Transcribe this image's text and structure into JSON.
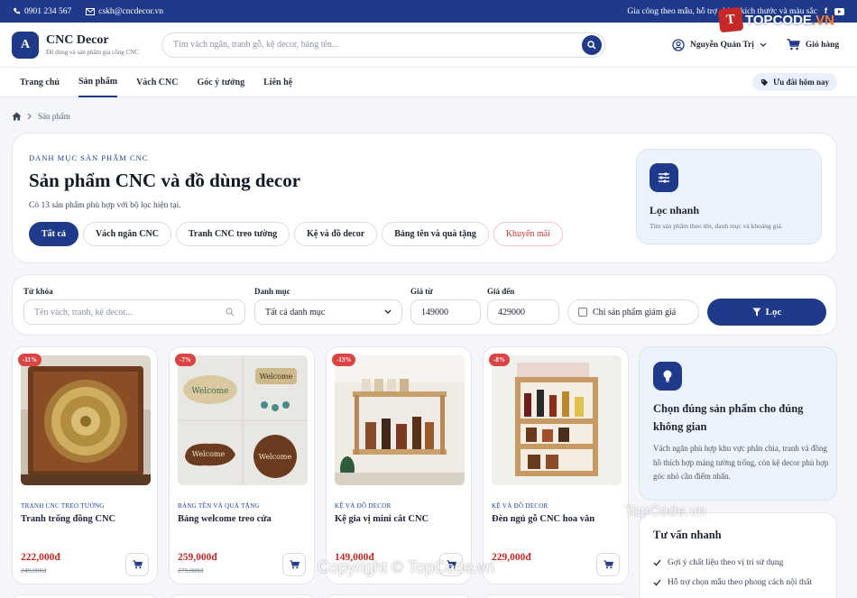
{
  "topbar": {
    "phone": "0901 234 567",
    "email": "cskh@cncdecor.vn",
    "promo": "Gia công theo mẫu, hỗ trợ chỉnh kích thước và màu sắc"
  },
  "brand": {
    "logo_letter": "A",
    "name": "CNC Decor",
    "tagline": "Đồ dùng và sản phẩm gia công CNC"
  },
  "search": {
    "placeholder": "Tìm vách ngăn, tranh gỗ, kệ decor, bảng tên..."
  },
  "user": {
    "name": "Nguyễn Quản Trị"
  },
  "cart": {
    "label": "Giỏ hàng"
  },
  "nav": {
    "items": [
      "Trang chủ",
      "Sản phẩm",
      "Vách CNC",
      "Góc ý tưởng",
      "Liên hệ"
    ],
    "active_index": 1,
    "deal_label": "Ưu đãi hôm nay"
  },
  "breadcrumb": {
    "current": "Sản phẩm"
  },
  "hero": {
    "kicker": "DANH MỤC SẢN PHẨM CNC",
    "title": "Sản phẩm CNC và đồ dùng decor",
    "subtitle": "Có 13 sản phẩm phù hợp với bộ lọc hiện tại.",
    "chips": [
      "Tất cả",
      "Vách ngăn CNC",
      "Tranh CNC treo tường",
      "Kệ và đồ decor",
      "Bảng tên và quà tặng",
      "Khuyến mãi"
    ],
    "quick_title": "Lọc nhanh",
    "quick_desc": "Tìm sản phẩm theo tên, danh mục và khoảng giá."
  },
  "filter": {
    "keyword_label": "Từ khóa",
    "keyword_placeholder": "Tên vách, tranh, kệ decor...",
    "category_label": "Danh mục",
    "category_value": "Tất cả danh mục",
    "price_from_label": "Giá từ",
    "price_from": "149000",
    "price_to_label": "Giá đến",
    "price_to": "429000",
    "discount_only": "Chỉ sản phẩm giảm giá",
    "submit": "Lọc"
  },
  "products": [
    {
      "badge": "-11%",
      "category": "TRANH CNC TREO TƯỜNG",
      "name": "Tranh trống đồng CNC",
      "price": "222,000đ",
      "old_price": "249,000đ"
    },
    {
      "badge": "-7%",
      "category": "BẢNG TÊN VÀ QUÀ TẶNG",
      "name": "Bảng welcome treo cửa",
      "price": "259,000đ",
      "old_price": "279,000đ"
    },
    {
      "badge": "-13%",
      "category": "KỆ VÀ ĐỒ DECOR",
      "name": "Kệ gia vị mini cắt CNC",
      "price": "149,000đ",
      "old_price": ""
    },
    {
      "badge": "-8%",
      "category": "KỆ VÀ ĐỒ DECOR",
      "name": "Đèn ngủ gỗ CNC hoa văn",
      "price": "229,000đ",
      "old_price": ""
    }
  ],
  "sidebar": {
    "tip_title": "Chọn đúng sản phẩm cho đúng không gian",
    "tip_desc": "Vách ngăn phù hợp khu vực phân chia, tranh và đồng hồ thích hợp mảng tường trống, còn kệ decor phù hợp góc nhỏ cần điểm nhấn.",
    "advice_title": "Tư vấn nhanh",
    "advice_items": [
      "Gợi ý chất liệu theo vị trí sử dụng",
      "Hỗ trợ chọn mẫu theo phong cách nội thất"
    ]
  },
  "watermark": {
    "logo_letter": "T",
    "logo_text_a": "TOPCODE",
    "logo_text_b": ".VN",
    "text1": "TopCode.vn",
    "text2": "Copyright © TopCode.vn"
  },
  "colors": {
    "primary": "#1f3a8a",
    "sale": "#c62828",
    "badge": "#d94545"
  }
}
